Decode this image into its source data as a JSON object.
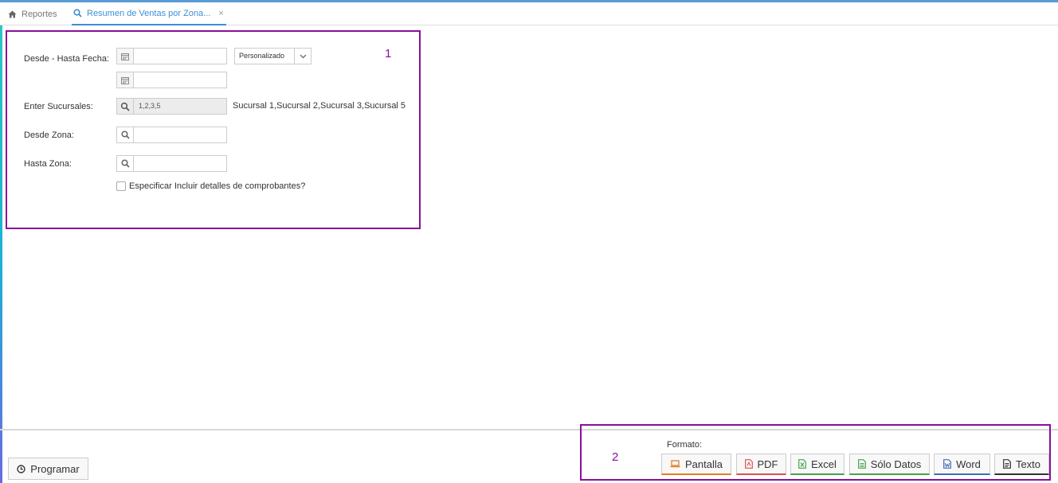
{
  "tabs": {
    "home": {
      "label": "Reportes",
      "icon": "home-icon"
    },
    "active": {
      "label": "Resumen de Ventas por Zona...",
      "icon": "search-icon",
      "close": "×"
    }
  },
  "markers": {
    "one": "1",
    "two": "2"
  },
  "form": {
    "fecha_label": "Desde - Hasta Fecha:",
    "fecha_desde_value": "",
    "fecha_hasta_value": "",
    "periodo_select": "Personalizado",
    "sucursales_label": "Enter Sucursales:",
    "sucursales_value": "1,2,3,5",
    "sucursales_desc": "Sucursal 1,Sucursal 2,Sucursal 3,Sucursal 5",
    "desde_zona_label": "Desde Zona:",
    "desde_zona_value": "",
    "hasta_zona_label": "Hasta Zona:",
    "hasta_zona_value": "",
    "detalles_label": "Especificar Incluir detalles de comprobantes?",
    "detalles_checked": false
  },
  "footer": {
    "programar_label": "Programar",
    "formato_label": "Formato:",
    "formats": {
      "pantalla": "Pantalla",
      "pdf": "PDF",
      "excel": "Excel",
      "solo_datos": "Sólo Datos",
      "word": "Word",
      "texto": "Texto"
    }
  },
  "colors": {
    "accent_blue": "#3d8fd6",
    "annotation_frame": "#8a0f9d",
    "pantalla": "#e67e22",
    "pdf": "#d9534f",
    "excel": "#4aa04a",
    "word": "#3d6fb6"
  }
}
